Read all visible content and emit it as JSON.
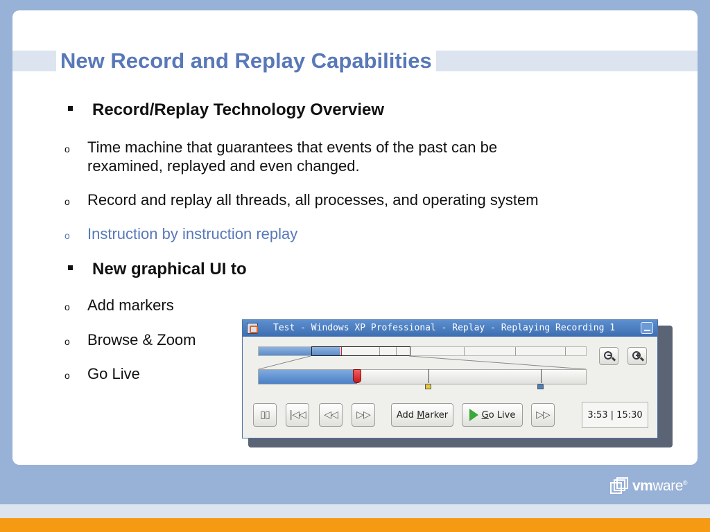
{
  "slide": {
    "title": "New Record and Replay Capabilities",
    "sections": [
      {
        "heading": "Record/Replay Technology Overview",
        "items": [
          {
            "lines": [
              "Time machine that guarantees that events of the past can be",
              "rexamined, replayed and even changed."
            ]
          },
          {
            "lines": [
              "Record and replay all threads, all processes, and operating system"
            ]
          },
          {
            "lines": [
              "Instruction by instruction replay"
            ],
            "accent": true
          }
        ]
      },
      {
        "heading": "New graphical UI to",
        "items": [
          {
            "lines": [
              "Add markers"
            ]
          },
          {
            "lines": [
              "Browse & Zoom"
            ]
          },
          {
            "lines": [
              "Go Live"
            ]
          }
        ]
      }
    ],
    "bullet_marker": "o",
    "logo": {
      "bold": "vm",
      "rest": "ware",
      "suffix": "®"
    }
  },
  "window": {
    "title": "Test - Windows XP Professional - Replay - Replaying Recording 1",
    "buttons": {
      "pause_glyph": "▯▯",
      "rewind_start_glyph": "|◁◁",
      "rewind_glyph": "◁◁",
      "forward_glyph": "▷▷",
      "add_marker_prefix": "Add ",
      "add_marker_underlined": "M",
      "add_marker_suffix": "arker",
      "go_live_underlined": "G",
      "go_live_suffix": "o Live",
      "fast_forward_glyph": "▷▷"
    },
    "time_display": "3:53 | 15:30",
    "progress": {
      "played_fraction": 0.3,
      "overview_played_fraction": 0.25
    },
    "markers": [
      {
        "position_fraction": 0.52,
        "color": "#e8c838"
      },
      {
        "position_fraction": 0.86,
        "color": "#4a7fc0"
      }
    ]
  },
  "colors": {
    "background": "#98b1d6",
    "title": "#5878b8",
    "accent_text": "#5878b8",
    "stripe_orange": "#f59a12",
    "titlebar": "#4a7dc0"
  }
}
